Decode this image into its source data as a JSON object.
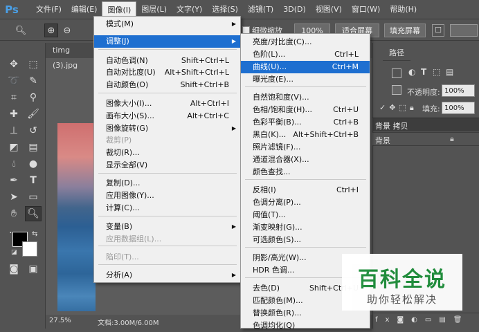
{
  "menubar": {
    "logo": "Ps",
    "items": [
      "文件(F)",
      "编辑(E)",
      "图像(I)",
      "图层(L)",
      "文字(Y)",
      "选择(S)",
      "滤镜(T)",
      "3D(D)",
      "视图(V)",
      "窗口(W)",
      "帮助(H)"
    ]
  },
  "options": {
    "checkbox_label": "细微缩放",
    "zoom_value": "100%",
    "fit_screen": "适合屏幕",
    "fill_screen": "填充屏幕"
  },
  "document": {
    "tab": "timg (3).jpg",
    "zoom": "27.5%",
    "doc_info": "文档:3.00M/6.00M"
  },
  "panels": {
    "path_tab": "路径",
    "opacity_label": "不透明度:",
    "opacity_value": "100%",
    "fill_label": "填充:",
    "fill_value": "100%",
    "layers": [
      "背景 拷贝",
      "背景"
    ]
  },
  "image_menu": {
    "items": [
      {
        "label": "模式(M)",
        "shortcut": "",
        "submenu": true
      },
      {
        "label": "调整(J)",
        "shortcut": "",
        "submenu": true,
        "highlight": true
      },
      {
        "label": "自动色调(N)",
        "shortcut": "Shift+Ctrl+L"
      },
      {
        "label": "自动对比度(U)",
        "shortcut": "Alt+Shift+Ctrl+L"
      },
      {
        "label": "自动颜色(O)",
        "shortcut": "Shift+Ctrl+B"
      },
      {
        "label": "图像大小(I)...",
        "shortcut": "Alt+Ctrl+I"
      },
      {
        "label": "画布大小(S)...",
        "shortcut": "Alt+Ctrl+C"
      },
      {
        "label": "图像旋转(G)",
        "shortcut": "",
        "submenu": true
      },
      {
        "label": "裁剪(P)",
        "shortcut": "",
        "disabled": true
      },
      {
        "label": "裁切(R)...",
        "shortcut": ""
      },
      {
        "label": "显示全部(V)",
        "shortcut": ""
      },
      {
        "label": "复制(D)...",
        "shortcut": ""
      },
      {
        "label": "应用图像(Y)...",
        "shortcut": ""
      },
      {
        "label": "计算(C)...",
        "shortcut": ""
      },
      {
        "label": "变量(B)",
        "shortcut": "",
        "submenu": true
      },
      {
        "label": "应用数据组(L)...",
        "shortcut": "",
        "disabled": true
      },
      {
        "label": "陷印(T)...",
        "shortcut": "",
        "disabled": true
      },
      {
        "label": "分析(A)",
        "shortcut": "",
        "submenu": true
      }
    ]
  },
  "adjust_menu": {
    "items": [
      {
        "label": "亮度/对比度(C)...",
        "shortcut": ""
      },
      {
        "label": "色阶(L)...",
        "shortcut": "Ctrl+L"
      },
      {
        "label": "曲线(U)...",
        "shortcut": "Ctrl+M",
        "highlight": true
      },
      {
        "label": "曝光度(E)...",
        "shortcut": ""
      },
      {
        "label": "自然饱和度(V)...",
        "shortcut": ""
      },
      {
        "label": "色相/饱和度(H)...",
        "shortcut": "Ctrl+U"
      },
      {
        "label": "色彩平衡(B)...",
        "shortcut": "Ctrl+B"
      },
      {
        "label": "黑白(K)...",
        "shortcut": "Alt+Shift+Ctrl+B"
      },
      {
        "label": "照片滤镜(F)...",
        "shortcut": ""
      },
      {
        "label": "通道混合器(X)...",
        "shortcut": ""
      },
      {
        "label": "颜色查找...",
        "shortcut": ""
      },
      {
        "label": "反相(I)",
        "shortcut": "Ctrl+I"
      },
      {
        "label": "色调分离(P)...",
        "shortcut": ""
      },
      {
        "label": "阈值(T)...",
        "shortcut": ""
      },
      {
        "label": "渐变映射(G)...",
        "shortcut": ""
      },
      {
        "label": "可选颜色(S)...",
        "shortcut": ""
      },
      {
        "label": "阴影/高光(W)...",
        "shortcut": ""
      },
      {
        "label": "HDR 色调...",
        "shortcut": ""
      },
      {
        "label": "去色(D)",
        "shortcut": "Shift+Ctrl+U"
      },
      {
        "label": "匹配颜色(M)...",
        "shortcut": ""
      },
      {
        "label": "替换颜色(R)...",
        "shortcut": ""
      },
      {
        "label": "色调均化(Q)",
        "shortcut": ""
      }
    ]
  },
  "watermark": {
    "title": "百科全说",
    "subtitle": "助你轻松解决"
  },
  "colors": {
    "highlight": "#1e6fd0",
    "ui_bg": "#535353",
    "menu_bg": "#f0f0f0",
    "watermark_green": "#1f8f3c"
  }
}
